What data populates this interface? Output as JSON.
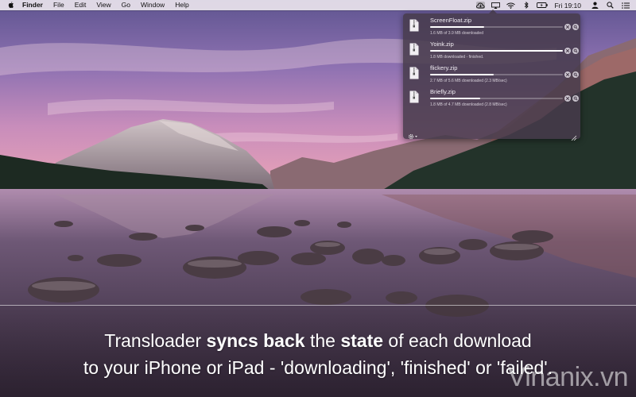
{
  "menubar": {
    "app_name": "Finder",
    "menus": [
      "File",
      "Edit",
      "View",
      "Go",
      "Window",
      "Help"
    ],
    "status_icons": [
      "transloader-icon",
      "airplay-icon",
      "wifi-icon",
      "bluetooth-icon",
      "battery-icon"
    ],
    "clock": "Fri 19:10",
    "right_icons": [
      "user-icon",
      "spotlight-icon",
      "notification-center-icon"
    ]
  },
  "downloads": [
    {
      "name": "ScreenFloat.zip",
      "status": "1.6 MB of 3.9 MB downloaded",
      "progress": 0.41
    },
    {
      "name": "Yoink.zip",
      "status": "1.8 MB downloaded - finished.",
      "progress": 1.0
    },
    {
      "name": "flickery.zip",
      "status": "2.7 MB of 5.6 MB downloaded (2.3 MB/sec)",
      "progress": 0.48
    },
    {
      "name": "Briefly.zip",
      "status": "1.8 MB of 4.7 MB downloaded (2.8 MB/sec)",
      "progress": 0.38
    }
  ],
  "caption": {
    "line1_a": "Transloader ",
    "line1_b": "syncs back",
    "line1_c": " the ",
    "line1_d": "state",
    "line1_e": " of each download",
    "line2": "to your iPhone or iPad - 'downloading', 'finished' or 'failed'."
  },
  "watermark": "Vinanix.vn",
  "colors": {
    "menubar": "#efeaf0",
    "popover": "#463a4a",
    "sky_top": "#6f5f97",
    "sky_mid": "#b080b8",
    "sky_horizon": "#e7a0b4",
    "water": "#3a2e40"
  }
}
